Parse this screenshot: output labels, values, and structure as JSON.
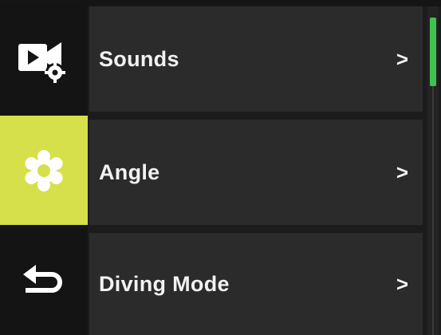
{
  "sidebar": {
    "tabs": [
      {
        "icon": "video-settings-icon",
        "active": false
      },
      {
        "icon": "gear-icon",
        "active": true
      },
      {
        "icon": "back-arrow-icon",
        "active": false
      }
    ],
    "active_color": "#d5e04a"
  },
  "menu": {
    "items": [
      {
        "label": "Sounds",
        "chevron": ">"
      },
      {
        "label": "Angle",
        "chevron": ">"
      },
      {
        "label": "Diving Mode",
        "chevron": ">"
      }
    ]
  },
  "scrollbar": {
    "thumb_color": "#3fc24f",
    "position_fraction": 0
  }
}
